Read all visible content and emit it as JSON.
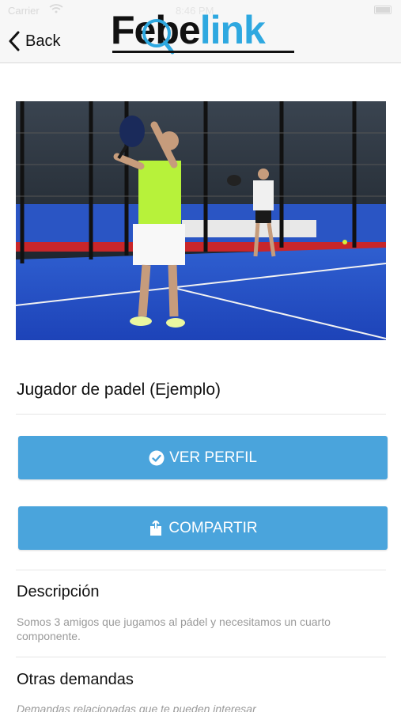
{
  "status_bar": {
    "carrier": "Carrier",
    "time": "8:46 PM"
  },
  "nav": {
    "back_label": "Back",
    "logo": {
      "part1": "Febe",
      "part2": "link",
      "dark_color": "#111111",
      "brand_color": "#2ea8e0"
    }
  },
  "hero": {
    "icon": "padel-photo"
  },
  "item": {
    "title": "Jugador de padel (Ejemplo)"
  },
  "actions": {
    "view_profile": {
      "label": "VER PERFIL",
      "icon": "check-circle-icon"
    },
    "share": {
      "label": "COMPARTIR",
      "icon": "share-icon"
    },
    "button_color": "#4aa4dc"
  },
  "description": {
    "heading": "Descripción",
    "text": "Somos 3 amigos que jugamos al pádel y necesitamos un cuarto componente."
  },
  "related": {
    "heading": "Otras demandas",
    "subtitle": "Demandas relacionadas que te pueden interesar"
  }
}
